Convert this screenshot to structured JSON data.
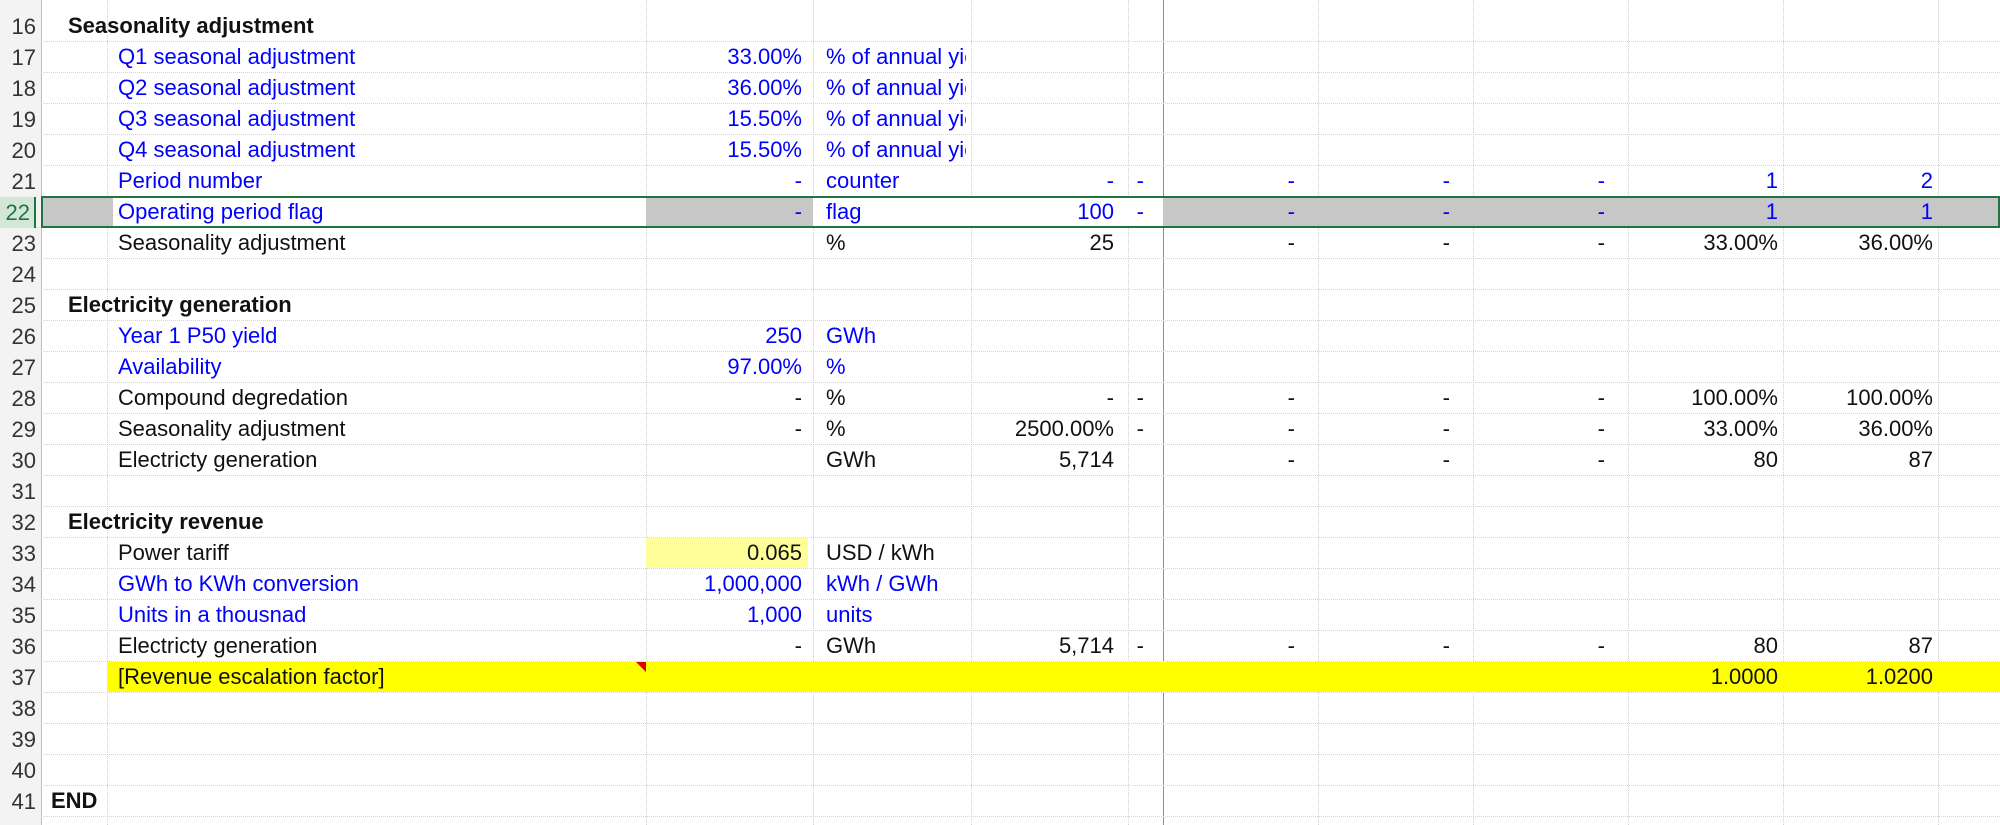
{
  "sheet": {
    "rows": [
      {
        "n": "16",
        "label": "Seasonality adjustment",
        "kind": "header"
      },
      {
        "n": "17",
        "label": "Q1 seasonal adjustment",
        "color": "blue",
        "input": "33.00%",
        "unit": "% of annual yield"
      },
      {
        "n": "18",
        "label": "Q2 seasonal adjustment",
        "color": "blue",
        "input": "36.00%",
        "unit": "% of annual yield"
      },
      {
        "n": "19",
        "label": "Q3 seasonal adjustment",
        "color": "blue",
        "input": "15.50%",
        "unit": "% of annual yield"
      },
      {
        "n": "20",
        "label": "Q4 seasonal adjustment",
        "color": "blue",
        "input": "15.50%",
        "unit": "% of annual yield"
      },
      {
        "n": "21",
        "label": "Period number",
        "color": "blue",
        "input": "-",
        "unit": "counter",
        "total": "-",
        "g": "-",
        "p1": "-",
        "p2": "-",
        "p3": "-",
        "p4": "1",
        "p5": "2"
      },
      {
        "n": "22",
        "label": "Operating period flag",
        "color": "blue",
        "input": "-",
        "unit": "flag",
        "total": "100",
        "g": "-",
        "p1": "-",
        "p2": "-",
        "p3": "-",
        "p4": "1",
        "p5": "1",
        "selected": true
      },
      {
        "n": "23",
        "label": "Seasonality adjustment",
        "color": "black",
        "input": "",
        "unit": "%",
        "total": "25",
        "g": "",
        "p1": "-",
        "p2": "-",
        "p3": "-",
        "p4": "33.00%",
        "p5": "36.00%"
      },
      {
        "n": "24",
        "label": ""
      },
      {
        "n": "25",
        "label": "Electricity generation",
        "kind": "header"
      },
      {
        "n": "26",
        "label": "Year 1 P50 yield",
        "color": "blue",
        "input": "250",
        "unit": "GWh"
      },
      {
        "n": "27",
        "label": "Availability",
        "color": "blue",
        "input": "97.00%",
        "unit": "%"
      },
      {
        "n": "28",
        "label": "Compound degredation",
        "color": "black",
        "input": "-",
        "unit": "%",
        "total": "-",
        "g": "-",
        "p1": "-",
        "p2": "-",
        "p3": "-",
        "p4": "100.00%",
        "p5": "100.00%"
      },
      {
        "n": "29",
        "label": "Seasonality adjustment",
        "color": "black",
        "input": "-",
        "unit": "%",
        "total": "2500.00%",
        "g": "-",
        "p1": "-",
        "p2": "-",
        "p3": "-",
        "p4": "33.00%",
        "p5": "36.00%"
      },
      {
        "n": "30",
        "label": "Electricty generation",
        "color": "black",
        "input": "",
        "unit": "GWh",
        "total": "5,714",
        "g": "",
        "p1": "-",
        "p2": "-",
        "p3": "-",
        "p4": "80",
        "p5": "87"
      },
      {
        "n": "31",
        "label": ""
      },
      {
        "n": "32",
        "label": "Electricity revenue",
        "kind": "header"
      },
      {
        "n": "33",
        "label": "Power tariff",
        "color": "black",
        "input": "0.065",
        "unit": "USD / kWh",
        "tariff": true
      },
      {
        "n": "34",
        "label": "GWh to KWh conversion",
        "color": "blue",
        "input": "1,000,000",
        "unit": "kWh / GWh"
      },
      {
        "n": "35",
        "label": "Units in a thousnad",
        "color": "blue",
        "input": "1,000",
        "unit": "units"
      },
      {
        "n": "36",
        "label": "Electricty generation",
        "color": "black",
        "input": "-",
        "unit": "GWh",
        "total": "5,714",
        "g": "-",
        "p1": "-",
        "p2": "-",
        "p3": "-",
        "p4": "80",
        "p5": "87"
      },
      {
        "n": "37",
        "label": "[Revenue escalation factor]",
        "color": "black",
        "input": "",
        "unit": "",
        "total": "",
        "g": "",
        "p1": "",
        "p2": "",
        "p3": "",
        "p4": "1.0000",
        "p5": "1.0200",
        "highlight": true
      },
      {
        "n": "38",
        "label": ""
      },
      {
        "n": "39",
        "label": ""
      },
      {
        "n": "40",
        "label": ""
      },
      {
        "n": "41",
        "label": "END",
        "kind": "end"
      }
    ]
  }
}
